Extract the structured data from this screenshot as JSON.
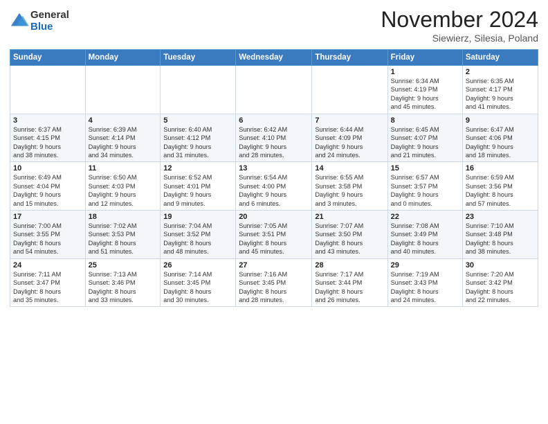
{
  "logo": {
    "general": "General",
    "blue": "Blue"
  },
  "header": {
    "month": "November 2024",
    "location": "Siewierz, Silesia, Poland"
  },
  "weekdays": [
    "Sunday",
    "Monday",
    "Tuesday",
    "Wednesday",
    "Thursday",
    "Friday",
    "Saturday"
  ],
  "weeks": [
    [
      {
        "day": "",
        "info": ""
      },
      {
        "day": "",
        "info": ""
      },
      {
        "day": "",
        "info": ""
      },
      {
        "day": "",
        "info": ""
      },
      {
        "day": "",
        "info": ""
      },
      {
        "day": "1",
        "info": "Sunrise: 6:34 AM\nSunset: 4:19 PM\nDaylight: 9 hours\nand 45 minutes."
      },
      {
        "day": "2",
        "info": "Sunrise: 6:35 AM\nSunset: 4:17 PM\nDaylight: 9 hours\nand 41 minutes."
      }
    ],
    [
      {
        "day": "3",
        "info": "Sunrise: 6:37 AM\nSunset: 4:15 PM\nDaylight: 9 hours\nand 38 minutes."
      },
      {
        "day": "4",
        "info": "Sunrise: 6:39 AM\nSunset: 4:14 PM\nDaylight: 9 hours\nand 34 minutes."
      },
      {
        "day": "5",
        "info": "Sunrise: 6:40 AM\nSunset: 4:12 PM\nDaylight: 9 hours\nand 31 minutes."
      },
      {
        "day": "6",
        "info": "Sunrise: 6:42 AM\nSunset: 4:10 PM\nDaylight: 9 hours\nand 28 minutes."
      },
      {
        "day": "7",
        "info": "Sunrise: 6:44 AM\nSunset: 4:09 PM\nDaylight: 9 hours\nand 24 minutes."
      },
      {
        "day": "8",
        "info": "Sunrise: 6:45 AM\nSunset: 4:07 PM\nDaylight: 9 hours\nand 21 minutes."
      },
      {
        "day": "9",
        "info": "Sunrise: 6:47 AM\nSunset: 4:06 PM\nDaylight: 9 hours\nand 18 minutes."
      }
    ],
    [
      {
        "day": "10",
        "info": "Sunrise: 6:49 AM\nSunset: 4:04 PM\nDaylight: 9 hours\nand 15 minutes."
      },
      {
        "day": "11",
        "info": "Sunrise: 6:50 AM\nSunset: 4:03 PM\nDaylight: 9 hours\nand 12 minutes."
      },
      {
        "day": "12",
        "info": "Sunrise: 6:52 AM\nSunset: 4:01 PM\nDaylight: 9 hours\nand 9 minutes."
      },
      {
        "day": "13",
        "info": "Sunrise: 6:54 AM\nSunset: 4:00 PM\nDaylight: 9 hours\nand 6 minutes."
      },
      {
        "day": "14",
        "info": "Sunrise: 6:55 AM\nSunset: 3:58 PM\nDaylight: 9 hours\nand 3 minutes."
      },
      {
        "day": "15",
        "info": "Sunrise: 6:57 AM\nSunset: 3:57 PM\nDaylight: 9 hours\nand 0 minutes."
      },
      {
        "day": "16",
        "info": "Sunrise: 6:59 AM\nSunset: 3:56 PM\nDaylight: 8 hours\nand 57 minutes."
      }
    ],
    [
      {
        "day": "17",
        "info": "Sunrise: 7:00 AM\nSunset: 3:55 PM\nDaylight: 8 hours\nand 54 minutes."
      },
      {
        "day": "18",
        "info": "Sunrise: 7:02 AM\nSunset: 3:53 PM\nDaylight: 8 hours\nand 51 minutes."
      },
      {
        "day": "19",
        "info": "Sunrise: 7:04 AM\nSunset: 3:52 PM\nDaylight: 8 hours\nand 48 minutes."
      },
      {
        "day": "20",
        "info": "Sunrise: 7:05 AM\nSunset: 3:51 PM\nDaylight: 8 hours\nand 45 minutes."
      },
      {
        "day": "21",
        "info": "Sunrise: 7:07 AM\nSunset: 3:50 PM\nDaylight: 8 hours\nand 43 minutes."
      },
      {
        "day": "22",
        "info": "Sunrise: 7:08 AM\nSunset: 3:49 PM\nDaylight: 8 hours\nand 40 minutes."
      },
      {
        "day": "23",
        "info": "Sunrise: 7:10 AM\nSunset: 3:48 PM\nDaylight: 8 hours\nand 38 minutes."
      }
    ],
    [
      {
        "day": "24",
        "info": "Sunrise: 7:11 AM\nSunset: 3:47 PM\nDaylight: 8 hours\nand 35 minutes."
      },
      {
        "day": "25",
        "info": "Sunrise: 7:13 AM\nSunset: 3:46 PM\nDaylight: 8 hours\nand 33 minutes."
      },
      {
        "day": "26",
        "info": "Sunrise: 7:14 AM\nSunset: 3:45 PM\nDaylight: 8 hours\nand 30 minutes."
      },
      {
        "day": "27",
        "info": "Sunrise: 7:16 AM\nSunset: 3:45 PM\nDaylight: 8 hours\nand 28 minutes."
      },
      {
        "day": "28",
        "info": "Sunrise: 7:17 AM\nSunset: 3:44 PM\nDaylight: 8 hours\nand 26 minutes."
      },
      {
        "day": "29",
        "info": "Sunrise: 7:19 AM\nSunset: 3:43 PM\nDaylight: 8 hours\nand 24 minutes."
      },
      {
        "day": "30",
        "info": "Sunrise: 7:20 AM\nSunset: 3:42 PM\nDaylight: 8 hours\nand 22 minutes."
      }
    ]
  ]
}
